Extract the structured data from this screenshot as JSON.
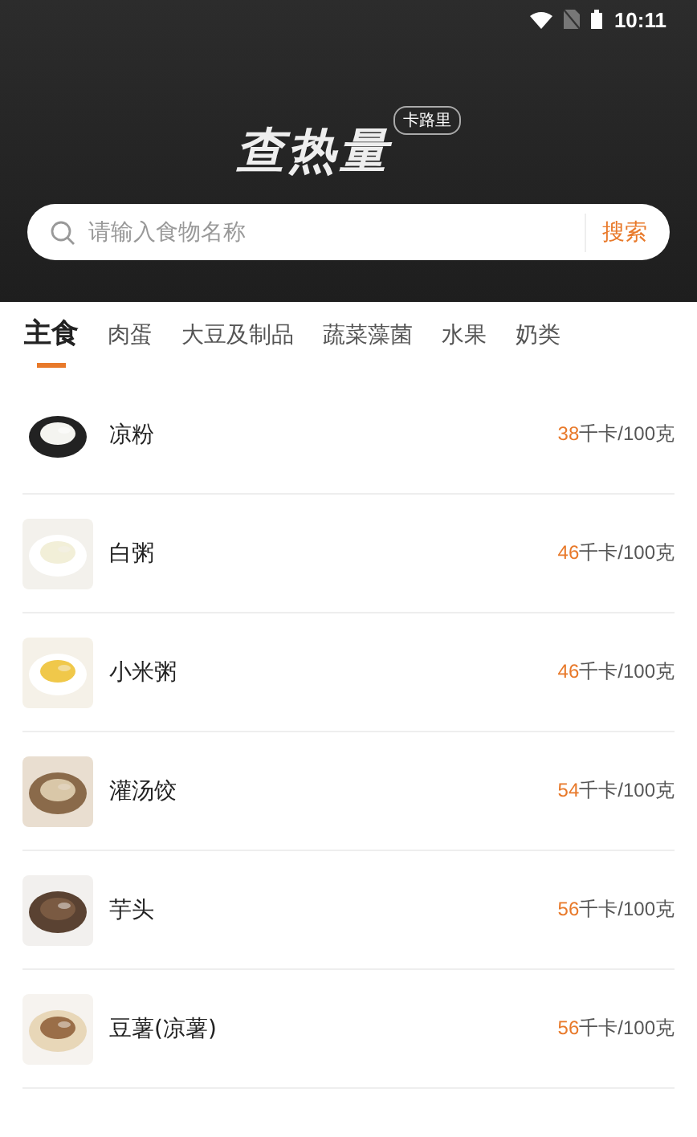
{
  "status_bar": {
    "time": "10:11"
  },
  "header": {
    "title": "查热量",
    "badge": "卡路里"
  },
  "search": {
    "placeholder": "请输入食物名称",
    "button": "搜索"
  },
  "tabs": [
    {
      "label": "主食",
      "selected": true
    },
    {
      "label": "肉蛋",
      "selected": false
    },
    {
      "label": "大豆及制品",
      "selected": false
    },
    {
      "label": "蔬菜藻菌",
      "selected": false
    },
    {
      "label": "水果",
      "selected": false
    },
    {
      "label": "奶类",
      "selected": false
    }
  ],
  "foods": [
    {
      "name": "凉粉",
      "calories": "38",
      "unit": "千卡/100克",
      "kind": "picture"
    },
    {
      "name": "白粥",
      "calories": "46",
      "unit": "千卡/100克",
      "kind": "picture"
    },
    {
      "name": "小米粥",
      "calories": "46",
      "unit": "千卡/100克",
      "kind": "picture"
    },
    {
      "name": "灌汤饺",
      "calories": "54",
      "unit": "千卡/100克",
      "kind": "picture"
    },
    {
      "name": "芋头",
      "calories": "56",
      "unit": "千卡/100克",
      "kind": "picture"
    },
    {
      "name": "豆薯(凉薯)",
      "calories": "56",
      "unit": "千卡/100克",
      "kind": "picture"
    }
  ]
}
